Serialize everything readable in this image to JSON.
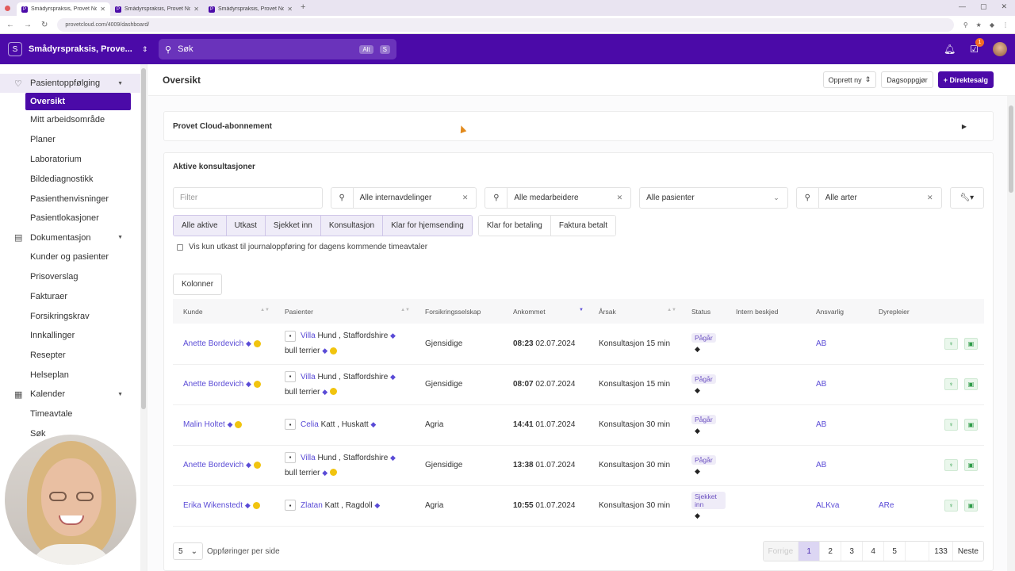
{
  "browser": {
    "tabs": [
      {
        "title": "Smådyrspraksis, Provet No"
      },
      {
        "title": "Smådyrspraksis, Provet Norge"
      },
      {
        "title": "Smådyrspraksis, Provet Norge"
      }
    ],
    "url": "provetcloud.com/4009/dashboard/"
  },
  "header": {
    "org_initial": "S",
    "org_name": "Smådyrspraksis, Prove...",
    "search_placeholder": "Søk",
    "shortcut_alt": "Alt",
    "shortcut_key": "S",
    "task_count": "1"
  },
  "sidebar": {
    "group_patient": "Pasientoppfølging",
    "items_patient": [
      "Oversikt",
      "Mitt arbeidsområde",
      "Planer",
      "Laboratorium",
      "Bildediagnostikk",
      "Pasienthenvisninger",
      "Pasientlokasjoner"
    ],
    "group_docs": "Dokumentasjon",
    "items_docs": [
      "Kunder og pasienter",
      "Prisoverslag",
      "Fakturaer",
      "Forsikringskrav",
      "Innkallinger",
      "Resepter",
      "Helseplan"
    ],
    "group_calendar": "Kalender",
    "items_calendar": [
      "Timeavtale",
      "Søk"
    ]
  },
  "page": {
    "title": "Oversikt",
    "btn_create": "Opprett ny",
    "btn_daily": "Dagsoppgjør",
    "btn_direct": "+ Direktesalg"
  },
  "subscription": {
    "title": "Provet Cloud-abonnement"
  },
  "consultations": {
    "title": "Aktive konsultasjoner",
    "filter_placeholder": "Filter",
    "dept": "Alle internavdelinger",
    "staff": "Alle medarbeidere",
    "patients": "Alle pasienter",
    "species": "Alle arter",
    "chips_on": [
      "Alle aktive",
      "Utkast",
      "Sjekket inn",
      "Konsultasjon",
      "Klar for hjemsending"
    ],
    "chips_off": [
      "Klar for betaling",
      "Faktura betalt"
    ],
    "checkbox_label": "Vis kun utkast til journaloppføring for dagens kommende timeavtaler",
    "columns_btn": "Kolonner",
    "headers": [
      "Kunde",
      "Pasienter",
      "Forsikringsselskap",
      "Ankommet",
      "Årsak",
      "Status",
      "Intern beskjed",
      "Ansvarlig",
      "Dyrepleier"
    ],
    "rows": [
      {
        "client": "Anette Bordevich",
        "pet": "Villa",
        "species": "Hund , Staffordshire",
        "breed2": "bull terrier",
        "insurer": "Gjensidige",
        "time": "08:23",
        "date": "02.07.2024",
        "reason": "Konsultasjon 15 min",
        "status": "Pågår",
        "resp": "AB",
        "nurse": ""
      },
      {
        "client": "Anette Bordevich",
        "pet": "Villa",
        "species": "Hund , Staffordshire",
        "breed2": "bull terrier",
        "insurer": "Gjensidige",
        "time": "08:07",
        "date": "02.07.2024",
        "reason": "Konsultasjon 15 min",
        "status": "Pågår",
        "resp": "AB",
        "nurse": ""
      },
      {
        "client": "Malin Holtet",
        "pet": "Celia",
        "species": "Katt , Huskatt",
        "breed2": "",
        "insurer": "Agria",
        "time": "14:41",
        "date": "01.07.2024",
        "reason": "Konsultasjon 30 min",
        "status": "Pågår",
        "resp": "AB",
        "nurse": ""
      },
      {
        "client": "Anette Bordevich",
        "pet": "Villa",
        "species": "Hund , Staffordshire",
        "breed2": "bull terrier",
        "insurer": "Gjensidige",
        "time": "13:38",
        "date": "01.07.2024",
        "reason": "Konsultasjon 30 min",
        "status": "Pågår",
        "resp": "AB",
        "nurse": ""
      },
      {
        "client": "Erika Wikenstedt",
        "pet": "Zlatan",
        "species": "Katt , Ragdoll",
        "breed2": "",
        "insurer": "Agria",
        "time": "10:55",
        "date": "01.07.2024",
        "reason": "Konsultasjon 30 min",
        "status": "Sjekket inn",
        "resp": "ALKva",
        "nurse": "ARe"
      }
    ],
    "per_page": "5",
    "per_page_label": "Oppføringer per side",
    "prev": "Forrige",
    "pages": [
      "1",
      "2",
      "3",
      "4",
      "5"
    ],
    "last_page": "133",
    "next": "Neste"
  },
  "colors": {
    "brand": "#4b0aa8",
    "link": "#5a4bd6",
    "success": "#2e9b48"
  }
}
